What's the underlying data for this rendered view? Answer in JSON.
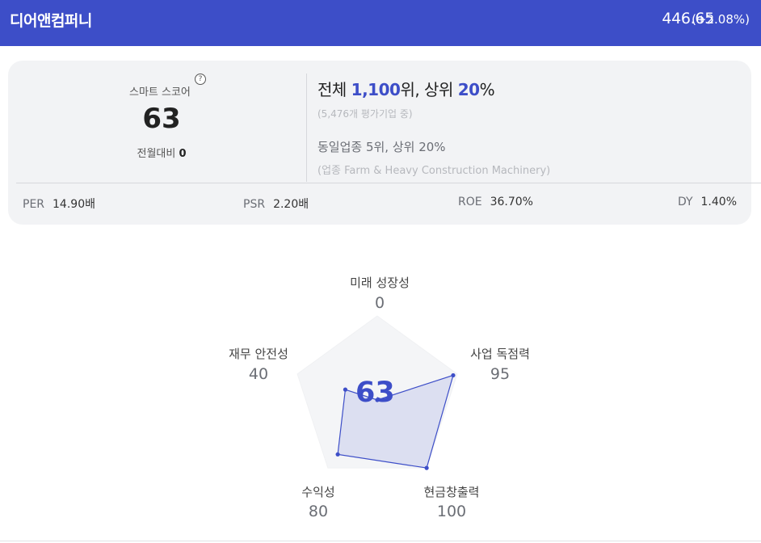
{
  "header": {
    "company_name": "디어앤컴퍼니",
    "price": "446.65",
    "change": "(+2.08%)",
    "background": "#3d4ec8"
  },
  "smart_score": {
    "label": "스마트 스코어",
    "help_icon": "?",
    "value": "63",
    "mom_label": "전월대비",
    "mom_value": "0"
  },
  "ranking": {
    "total_prefix": "전체 ",
    "total_rank": "1,100",
    "total_mid": "위, 상위 ",
    "total_percent": "20",
    "total_suffix": "%",
    "companies_evaluated": "(5,476개 평가기업 중)",
    "industry_rank": "동일업종 5위, 상위 20%",
    "industry_name": "(업종 Farm & Heavy Construction Machinery)"
  },
  "metrics": [
    {
      "label": "PER",
      "value": "14.90배"
    },
    {
      "label": "PSR",
      "value": "2.20배"
    },
    {
      "label": "ROE",
      "value": "36.70%"
    },
    {
      "label": "DY",
      "value": "1.40%"
    }
  ],
  "radar": {
    "center_score": "63",
    "max": 100,
    "accent": "#3d4ec8",
    "axes": [
      {
        "label": "미래 성장성",
        "value": 0
      },
      {
        "label": "사업 독점력",
        "value": 95
      },
      {
        "label": "현금창출력",
        "value": 100
      },
      {
        "label": "수익성",
        "value": 80
      },
      {
        "label": "재무 안전성",
        "value": 40
      }
    ]
  }
}
